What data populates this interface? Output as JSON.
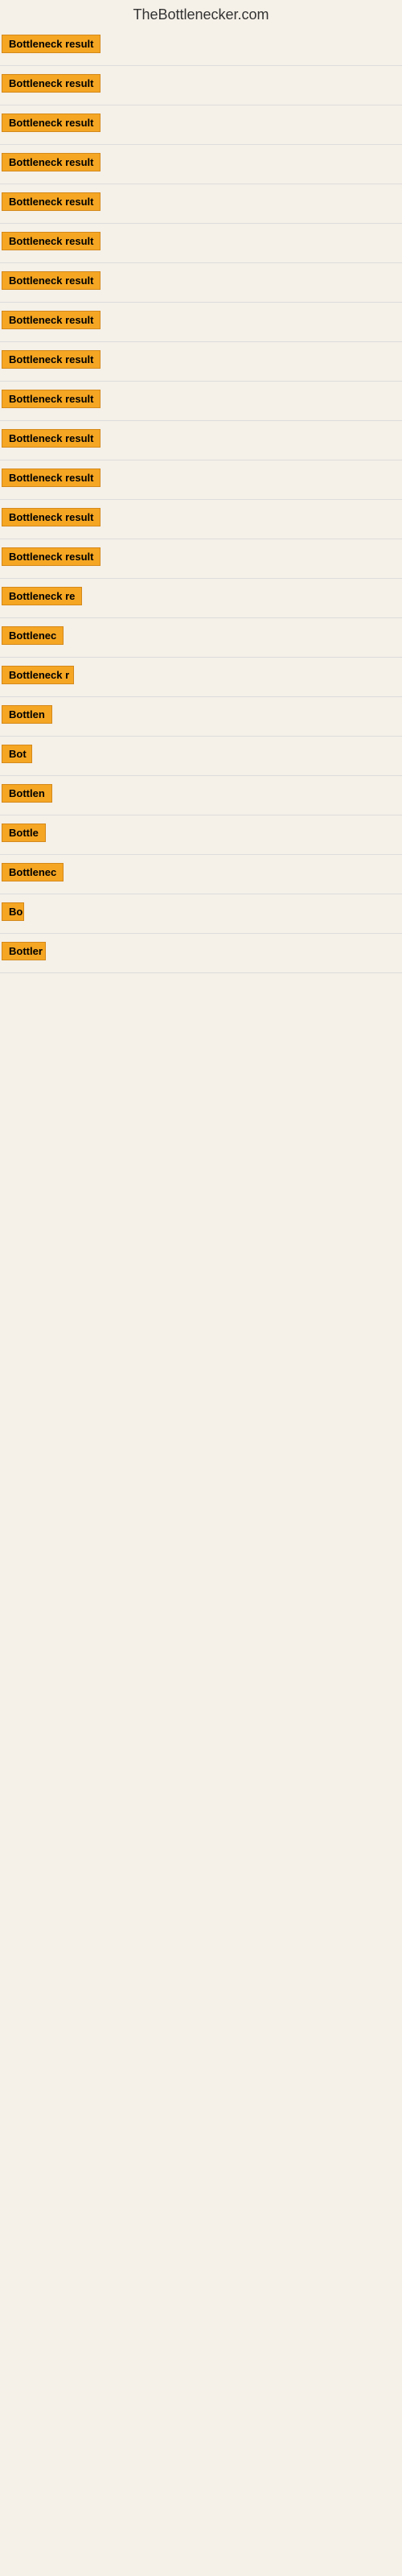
{
  "header": {
    "site_title": "TheBottlenecker.com"
  },
  "results": [
    {
      "id": 1,
      "label": "Bottleneck result",
      "width": 130
    },
    {
      "id": 2,
      "label": "Bottleneck result",
      "width": 130
    },
    {
      "id": 3,
      "label": "Bottleneck result",
      "width": 130
    },
    {
      "id": 4,
      "label": "Bottleneck result",
      "width": 130
    },
    {
      "id": 5,
      "label": "Bottleneck result",
      "width": 130
    },
    {
      "id": 6,
      "label": "Bottleneck result",
      "width": 130
    },
    {
      "id": 7,
      "label": "Bottleneck result",
      "width": 130
    },
    {
      "id": 8,
      "label": "Bottleneck result",
      "width": 130
    },
    {
      "id": 9,
      "label": "Bottleneck result",
      "width": 130
    },
    {
      "id": 10,
      "label": "Bottleneck result",
      "width": 130
    },
    {
      "id": 11,
      "label": "Bottleneck result",
      "width": 130
    },
    {
      "id": 12,
      "label": "Bottleneck result",
      "width": 130
    },
    {
      "id": 13,
      "label": "Bottleneck result",
      "width": 130
    },
    {
      "id": 14,
      "label": "Bottleneck result",
      "width": 130
    },
    {
      "id": 15,
      "label": "Bottleneck re",
      "width": 105
    },
    {
      "id": 16,
      "label": "Bottlenec",
      "width": 80
    },
    {
      "id": 17,
      "label": "Bottleneck r",
      "width": 90
    },
    {
      "id": 18,
      "label": "Bottlen",
      "width": 68
    },
    {
      "id": 19,
      "label": "Bot",
      "width": 38
    },
    {
      "id": 20,
      "label": "Bottlen",
      "width": 68
    },
    {
      "id": 21,
      "label": "Bottle",
      "width": 58
    },
    {
      "id": 22,
      "label": "Bottlenec",
      "width": 78
    },
    {
      "id": 23,
      "label": "Bo",
      "width": 28
    },
    {
      "id": 24,
      "label": "Bottler",
      "width": 55
    }
  ]
}
